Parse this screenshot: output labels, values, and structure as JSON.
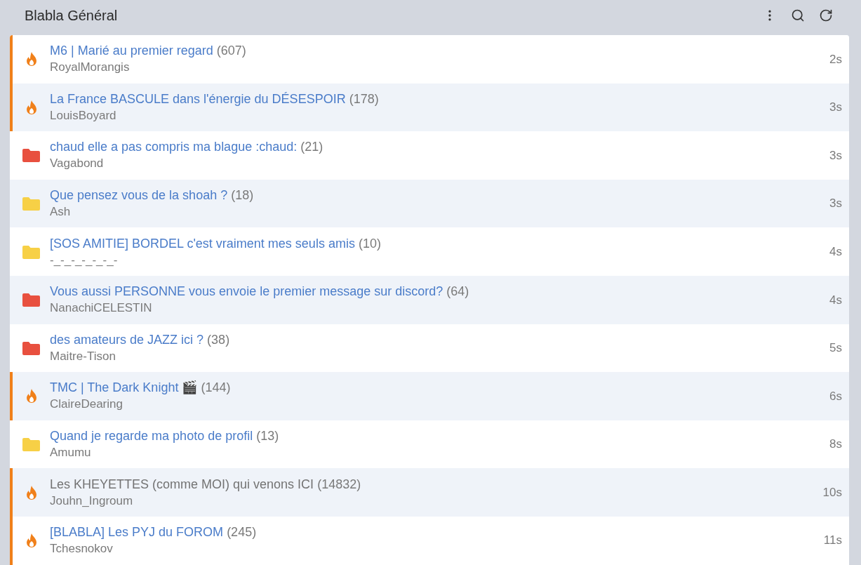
{
  "header": {
    "title": "Blabla Général"
  },
  "topics": [
    {
      "kind": "hot",
      "title": "M6 | Marié au premier regard",
      "count": "(607)",
      "author": "RoyalMorangis",
      "time": "2s",
      "visited": false
    },
    {
      "kind": "hot",
      "title": "La France BASCULE dans l'énergie du DÉSESPOIR",
      "count": "(178)",
      "author": "LouisBoyard",
      "time": "3s",
      "visited": false
    },
    {
      "kind": "folder",
      "color": "#e8503f",
      "title": "chaud elle a pas compris ma blague :chaud:",
      "count": "(21)",
      "author": "Vagabond",
      "time": "3s",
      "visited": false
    },
    {
      "kind": "folder",
      "color": "#f7d046",
      "title": "Que pensez vous de la shoah ?",
      "count": "(18)",
      "author": "Ash",
      "time": "3s",
      "visited": false
    },
    {
      "kind": "folder",
      "color": "#f7d046",
      "title": "[SOS AMITIE] BORDEL c'est vraiment mes seuls amis",
      "count": "(10)",
      "author": "-_-_-_-_-_-_-",
      "time": "4s",
      "visited": false
    },
    {
      "kind": "folder",
      "color": "#e8503f",
      "title": "Vous aussi PERSONNE vous envoie le premier message sur discord?",
      "count": "(64)",
      "author": "NanachiCELESTIN",
      "time": "4s",
      "visited": false
    },
    {
      "kind": "folder",
      "color": "#e8503f",
      "title": "des amateurs de JAZZ ici ?",
      "count": "(38)",
      "author": "Maitre-Tison",
      "time": "5s",
      "visited": false
    },
    {
      "kind": "hot",
      "title": "TMC | The Dark Knight 🎬",
      "count": "(144)",
      "author": "ClaireDearing",
      "time": "6s",
      "visited": false
    },
    {
      "kind": "folder",
      "color": "#f7d046",
      "title": "Quand je regarde ma photo de profil",
      "count": "(13)",
      "author": "Amumu",
      "time": "8s",
      "visited": false
    },
    {
      "kind": "hot",
      "title": "Les KHEYETTES (comme MOI) qui venons ICI",
      "count": "(14832)",
      "author": "Jouhn_Ingroum",
      "time": "10s",
      "visited": true
    },
    {
      "kind": "hot",
      "title": "[BLABLA] Les PYJ du FOROM",
      "count": "(245)",
      "author": "Tchesnokov",
      "time": "11s",
      "visited": false
    }
  ]
}
